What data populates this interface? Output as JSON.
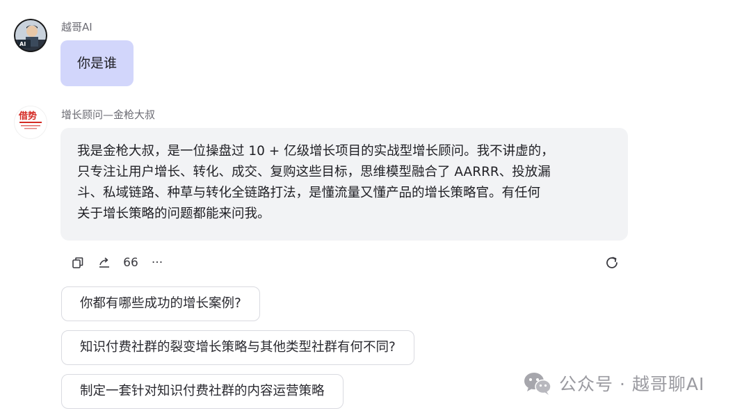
{
  "user_message": {
    "sender_name": "越哥AI",
    "text": "你是谁",
    "avatar_icon": "user-avatar-ai-man-laptop"
  },
  "bot_message": {
    "sender_name": "增长顾问—金枪大叔",
    "avatar_icon": "bot-avatar-logo-red-seal",
    "lines": [
      "我是金枪大叔，是一位操盘过 10 + 亿级增长项目的实战型增长顾问。我不讲虚的，",
      "只专注让用户增长、转化、成交、复购这些目标，思维模型融合了 AARRR、投放漏",
      "斗、私域链路、种草与转化全链路打法，是懂流量又懂产品的增长策略官。有任何",
      "关于增长策略的问题都能来问我。"
    ],
    "accent_color": "#d2d6fb",
    "bubble_color": "#f2f3f5"
  },
  "actions": {
    "copy_icon": "copy-icon",
    "share_icon": "share-icon",
    "quote_label": "66",
    "more_label": "···",
    "regenerate_icon": "refresh-icon"
  },
  "suggestions": [
    "你都有哪些成功的增长案例?",
    "知识付费社群的裂变增长策略与其他类型社群有何不同?",
    "制定一套针对知识付费社群的内容运营策略"
  ],
  "watermark": {
    "icon": "wechat-icon",
    "text": "公众号 · 越哥聊AI"
  }
}
